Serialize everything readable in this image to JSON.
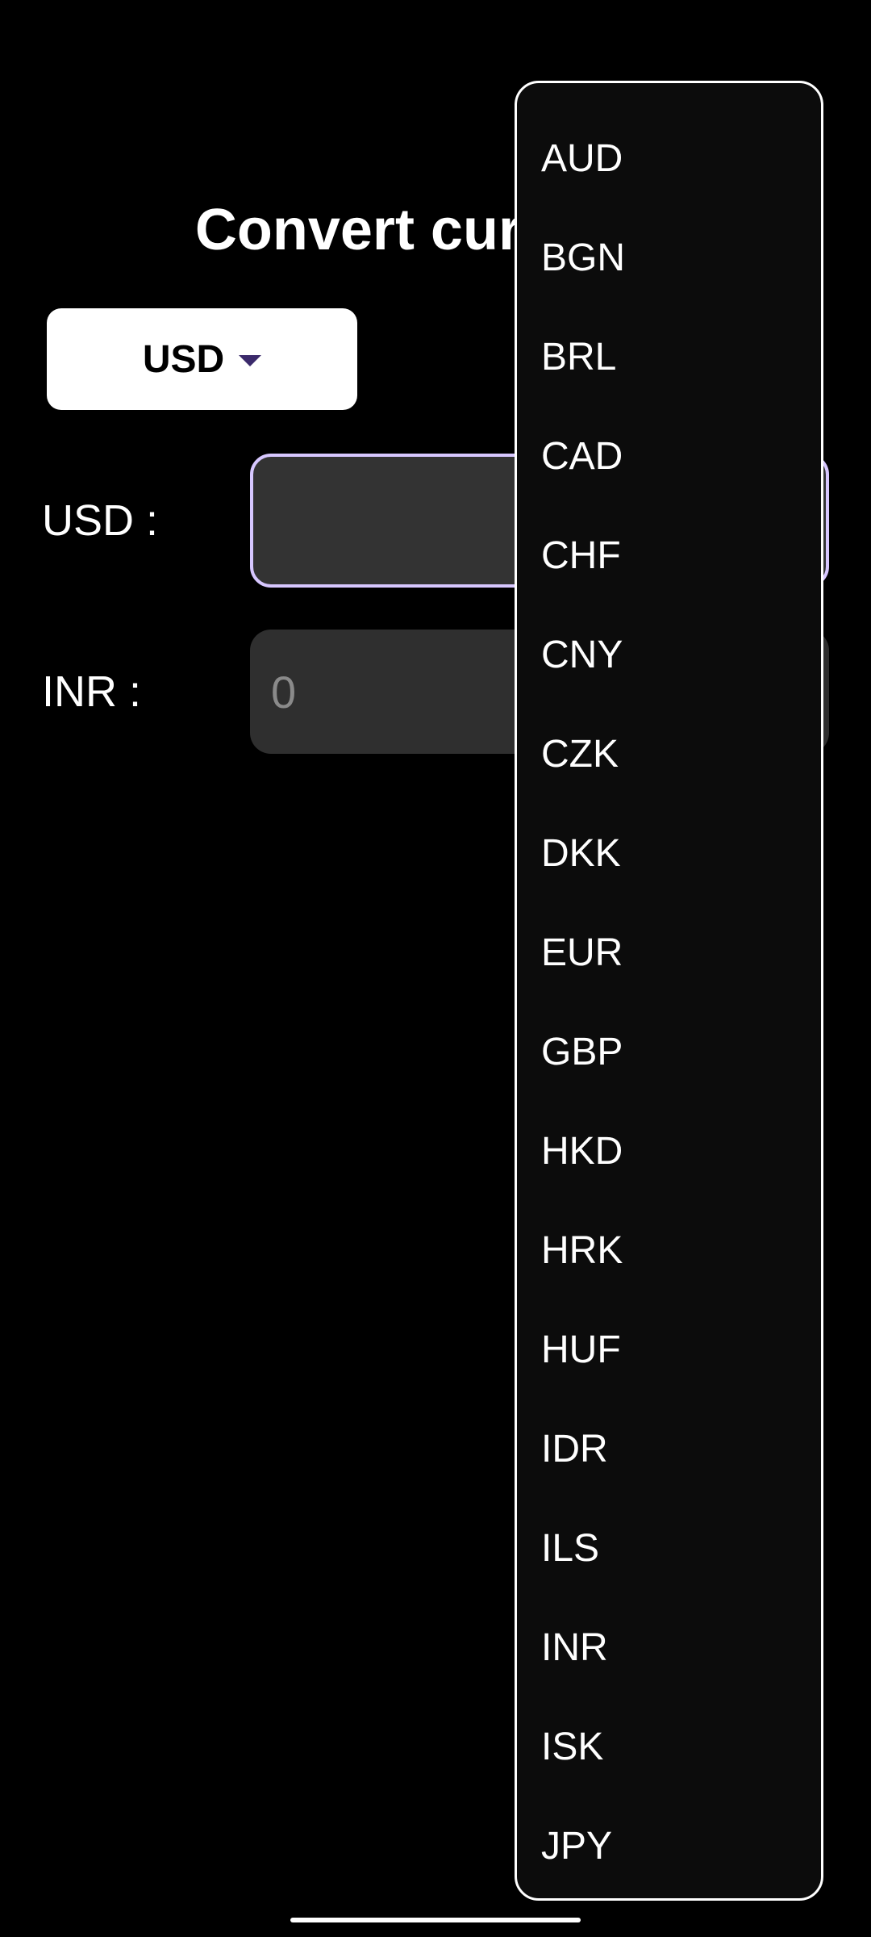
{
  "title": "Convert currency",
  "selector": {
    "selected": "USD",
    "caret_icon": "caret-down-icon"
  },
  "rows": [
    {
      "label": "USD :",
      "value": ""
    },
    {
      "label": "INR :",
      "value": "",
      "placeholder": "0"
    }
  ],
  "dropdown": {
    "items": [
      "AUD",
      "BGN",
      "BRL",
      "CAD",
      "CHF",
      "CNY",
      "CZK",
      "DKK",
      "EUR",
      "GBP",
      "HKD",
      "HRK",
      "HUF",
      "IDR",
      "ILS",
      "INR",
      "ISK",
      "JPY"
    ]
  },
  "colors": {
    "background": "#000000",
    "focus_outline": "#d7c7ff",
    "field_bg": "#2f2f2f",
    "caret": "#3b2a6b"
  }
}
